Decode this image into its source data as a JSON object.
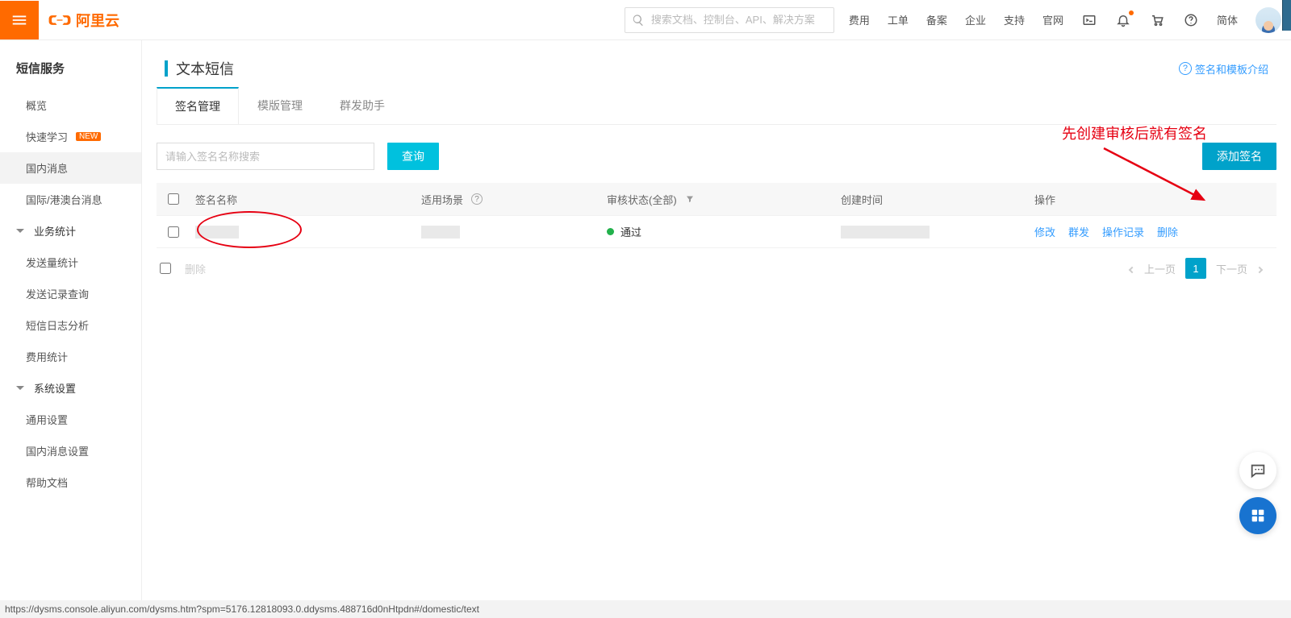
{
  "header": {
    "brand": "阿里云",
    "search_placeholder": "搜索文档、控制台、API、解决方案",
    "links": [
      "费用",
      "工单",
      "备案",
      "企业",
      "支持",
      "官网"
    ],
    "lang": "简体"
  },
  "side": {
    "title": "短信服务",
    "items": [
      {
        "label": "概览",
        "sub": true
      },
      {
        "label": "快速学习",
        "sub": true,
        "badge": "NEW"
      },
      {
        "label": "国内消息",
        "sub": true,
        "active": true
      },
      {
        "label": "国际/港澳台消息",
        "sub": true
      },
      {
        "label": "业务统计",
        "group": true
      },
      {
        "label": "发送量统计",
        "sub": true
      },
      {
        "label": "发送记录查询",
        "sub": true
      },
      {
        "label": "短信日志分析",
        "sub": true
      },
      {
        "label": "费用统计",
        "sub": true
      },
      {
        "label": "系统设置",
        "group": true
      },
      {
        "label": "通用设置",
        "sub": true
      },
      {
        "label": "国内消息设置",
        "sub": true
      },
      {
        "label": "帮助文档",
        "sub": true
      }
    ]
  },
  "page": {
    "title": "文本短信",
    "help_link": "签名和模板介绍",
    "tabs": [
      "签名管理",
      "模版管理",
      "群发助手"
    ],
    "search_placeholder": "请输入签名名称搜索",
    "query_btn": "查询",
    "add_btn": "添加签名",
    "annotation": "先创建审核后就有签名"
  },
  "table": {
    "columns": [
      "签名名称",
      "适用场景",
      "审核状态(全部)",
      "创建时间",
      "操作"
    ],
    "row": {
      "status": "通过",
      "ops": [
        "修改",
        "群发",
        "操作记录",
        "删除"
      ]
    },
    "bulk_delete": "删除",
    "pager": {
      "prev": "上一页",
      "current": "1",
      "next": "下一页"
    }
  },
  "status_url": "https://dysms.console.aliyun.com/dysms.htm?spm=5176.12818093.0.ddysms.488716d0nHtpdn#/domestic/text"
}
